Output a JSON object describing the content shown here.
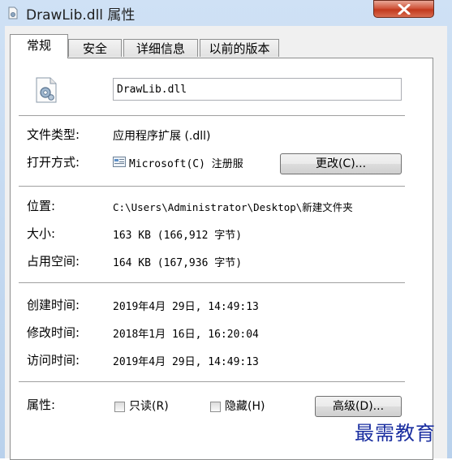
{
  "window": {
    "title": "DrawLib.dll 属性"
  },
  "tabs": [
    {
      "label": "常规",
      "active": true
    },
    {
      "label": "安全",
      "active": false
    },
    {
      "label": "详细信息",
      "active": false
    },
    {
      "label": "以前的版本",
      "active": false
    }
  ],
  "general": {
    "filename": "DrawLib.dll",
    "file_type_label": "文件类型:",
    "file_type_value": "应用程序扩展 (.dll)",
    "open_with_label": "打开方式:",
    "open_with_value": "Microsoft(C) 注册服",
    "change_button": "更改(C)...",
    "location_label": "位置:",
    "location_value": "C:\\Users\\Administrator\\Desktop\\新建文件夹",
    "size_label": "大小:",
    "size_value": "163 KB (166,912 字节)",
    "disk_size_label": "占用空间:",
    "disk_size_value": "164 KB (167,936 字节)",
    "created_label": "创建时间:",
    "created_value": "2019年4月 29日, 14:49:13",
    "modified_label": "修改时间:",
    "modified_value": "2018年1月 16日, 16:20:04",
    "accessed_label": "访问时间:",
    "accessed_value": "2019年4月 29日, 14:49:13",
    "attributes_label": "属性:",
    "readonly_label": "只读(R)",
    "readonly_checked": false,
    "hidden_label": "隐藏(H)",
    "hidden_checked": false,
    "advanced_button": "高级(D)..."
  },
  "watermark": "最需教育",
  "icons": {
    "title": "dll-file-icon",
    "file": "dll-file-gear-icon",
    "open_with": "registry-app-icon",
    "close": "close-icon"
  }
}
